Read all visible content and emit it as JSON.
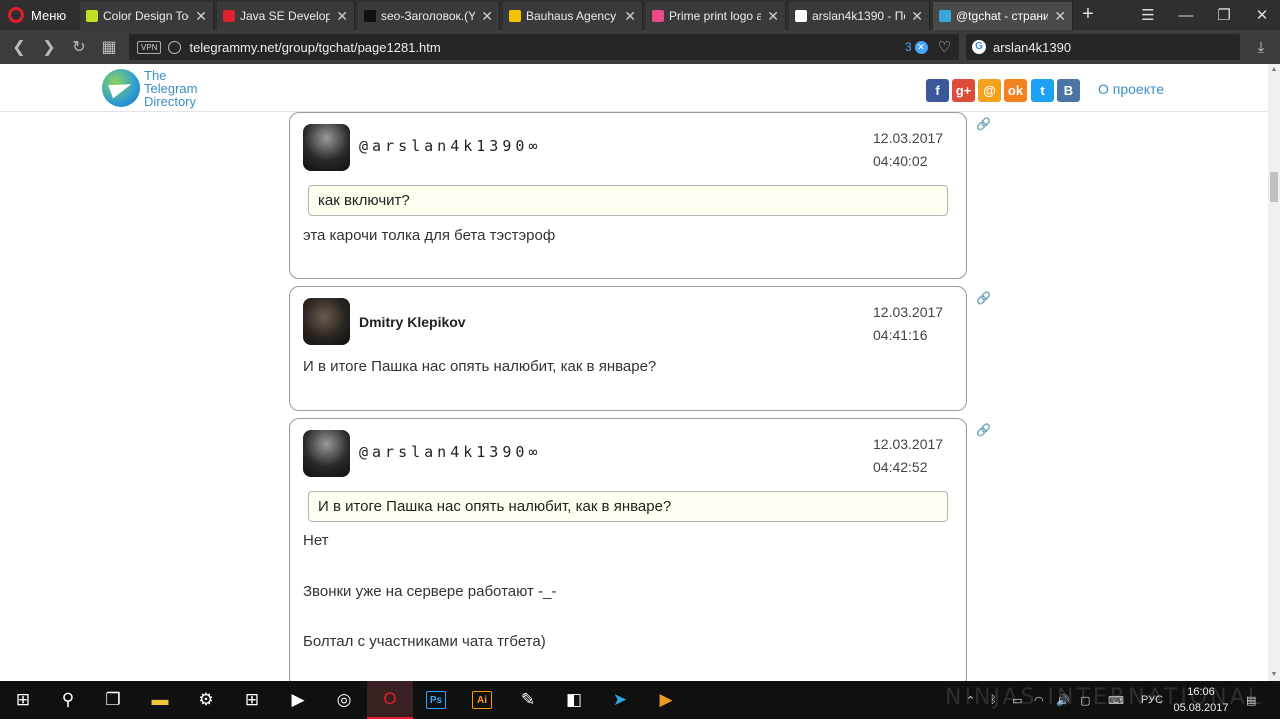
{
  "browser": {
    "menu_label": "Меню",
    "tabs": [
      {
        "title": "Color Design Tools",
        "icon": "pencil-icon",
        "icon_color": "#c5e020"
      },
      {
        "title": "Java SE Developme",
        "icon": "oracle-icon",
        "icon_color": "#e0202a"
      },
      {
        "title": "seo-Заголовок.(Yo",
        "icon": "plane-icon",
        "icon_color": "#111111"
      },
      {
        "title": "Bauhaus Agency",
        "icon": "smiley-icon",
        "icon_color": "#f2c200"
      },
      {
        "title": "Prime print logo an",
        "icon": "dribbble-icon",
        "icon_color": "#ea4c89"
      },
      {
        "title": "arslan4k1390 - По",
        "icon": "google-icon",
        "icon_color": "#ffffff"
      },
      {
        "title": "@tgchat - страниц",
        "icon": "telegram-directory-icon",
        "icon_color": "#3aa6d8"
      }
    ],
    "url": "telegrammy.net/group/tgchat/page1281.htm",
    "vpn_label": "VPN",
    "blocked_count": "3",
    "search_query": "arslan4k1390"
  },
  "site": {
    "brand_lines": [
      "The",
      "Telegram",
      "Directory"
    ],
    "social_icons": [
      {
        "name": "facebook-icon",
        "glyph": "f",
        "color": "#3b5998"
      },
      {
        "name": "google-plus-icon",
        "glyph": "g+",
        "color": "#dd4b39"
      },
      {
        "name": "mail-ru-icon",
        "glyph": "@",
        "color": "#f4a21c"
      },
      {
        "name": "odnoklassniki-icon",
        "glyph": "ok",
        "color": "#f58220"
      },
      {
        "name": "twitter-icon",
        "glyph": "t",
        "color": "#1da1f2"
      },
      {
        "name": "vkontakte-icon",
        "glyph": "B",
        "color": "#4c75a3"
      }
    ],
    "about_link": "О проекте"
  },
  "messages": [
    {
      "user": "@arslan4k1390∞",
      "date": "12.03.2017",
      "time": "04:40:02",
      "quote": "как включит?",
      "lines": [
        "эта карочи толка для бета тэстэроф"
      ]
    },
    {
      "user": "Dmitry Klepikov",
      "date": "12.03.2017",
      "time": "04:41:16",
      "quote": "",
      "lines": [
        "И в итоге Пашка нас опять налюбит, как в январе?"
      ]
    },
    {
      "user": "@arslan4k1390∞",
      "date": "12.03.2017",
      "time": "04:42:52",
      "quote": "И в итоге Пашка нас опять налюбит, как в январе?",
      "lines": [
        "Нет",
        "Звонки уже на сервере работают -_-",
        "Болтал с участниками чата тгбета)"
      ]
    }
  ],
  "taskbar": {
    "apps": [
      {
        "name": "start-button",
        "glyph": "⊞"
      },
      {
        "name": "search-button",
        "glyph": "⚲"
      },
      {
        "name": "task-view-button",
        "glyph": "❐"
      },
      {
        "name": "file-explorer-app",
        "glyph": "▬",
        "color": "#f3c13a"
      },
      {
        "name": "settings-app",
        "glyph": "⚙"
      },
      {
        "name": "store-app",
        "glyph": "⊞"
      },
      {
        "name": "video-editor-app",
        "glyph": "▶"
      },
      {
        "name": "chrome-like-app",
        "glyph": "◎"
      },
      {
        "name": "opera-app",
        "glyph": "O",
        "color": "#e0202a"
      },
      {
        "name": "photoshop-app",
        "glyph": "Ps",
        "color": "#31a8ff"
      },
      {
        "name": "illustrator-app",
        "glyph": "Ai",
        "color": "#ff9a00"
      },
      {
        "name": "paint-app",
        "glyph": "✎"
      },
      {
        "name": "code-app",
        "glyph": "◧"
      },
      {
        "name": "telegram-app",
        "glyph": "➤",
        "color": "#2ca5e0"
      },
      {
        "name": "media-player-app",
        "glyph": "▶",
        "color": "#f29c1f"
      }
    ],
    "watermark": "NINJAS INTERNATIONAL",
    "language": "РУС",
    "time": "16:06",
    "date": "05.08.2017"
  }
}
